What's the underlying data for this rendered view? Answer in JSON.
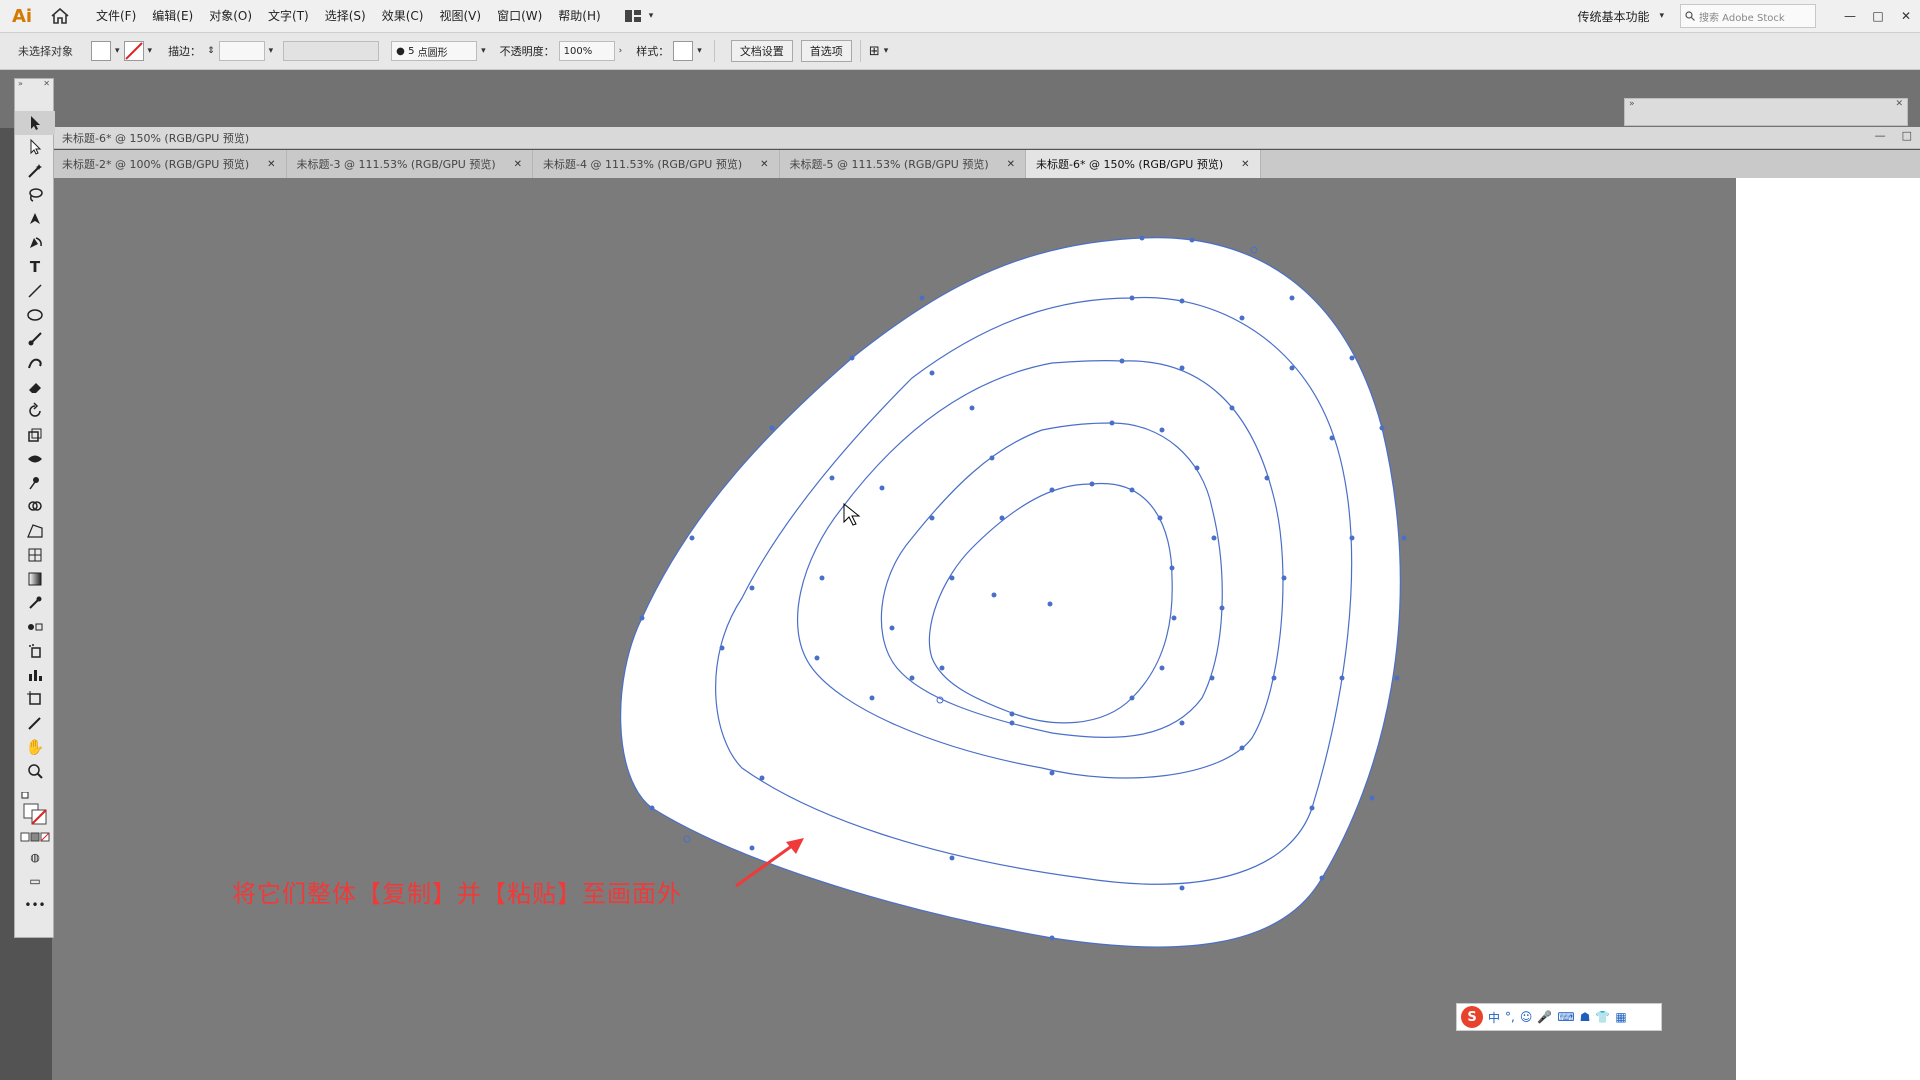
{
  "app": {
    "logo": "Ai",
    "menus": [
      "文件(F)",
      "编辑(E)",
      "对象(O)",
      "文字(T)",
      "选择(S)",
      "效果(C)",
      "视图(V)",
      "窗口(W)",
      "帮助(H)"
    ],
    "workspace": "传统基本功能",
    "search_placeholder": "搜索 Adobe Stock"
  },
  "control_bar": {
    "selection_status": "未选择对象",
    "stroke_label": "描边：",
    "brush_size": "5",
    "brush_shape": "点圆形",
    "opacity_label": "不透明度：",
    "opacity_value": "100%",
    "style_label": "样式：",
    "doc_settings_btn": "文档设置",
    "preferences_btn": "首选项"
  },
  "document": {
    "title": "未标题-6* @ 150% (RGB/GPU 预览)",
    "tabs": [
      {
        "label": "未标题-2* @ 100% (RGB/GPU 预览)",
        "active": false
      },
      {
        "label": "未标题-3 @ 111.53% (RGB/GPU 预览)",
        "active": false
      },
      {
        "label": "未标题-4 @ 111.53% (RGB/GPU 预览)",
        "active": false
      },
      {
        "label": "未标题-5 @ 111.53% (RGB/GPU 预览)",
        "active": false
      },
      {
        "label": "未标题-6* @ 150% (RGB/GPU 预览)",
        "active": true
      }
    ]
  },
  "caption": "将它们整体【复制】并【粘贴】至画面外",
  "ime": {
    "mode": "中"
  },
  "colors": {
    "accent_path": "#4a6fc8",
    "caption_red": "#f03a3a",
    "canvas": "#7b7b7b"
  }
}
